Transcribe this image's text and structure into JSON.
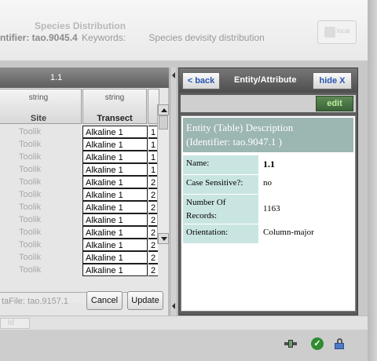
{
  "header": {
    "title": "Species Distribution",
    "id_label": "ntifier: tao.9045.4",
    "keywords_label": "Keywords:",
    "keywords_value": "Species devisity distribution",
    "badge": "local"
  },
  "table": {
    "title": "1.1",
    "columns": [
      {
        "type": "string",
        "name": "Site"
      },
      {
        "type": "string",
        "name": "Transect"
      }
    ],
    "rows": [
      {
        "site": "Toolik",
        "transect": "Alkaline 1",
        "extra": "1"
      },
      {
        "site": "Toolik",
        "transect": "Alkaline 1",
        "extra": "1"
      },
      {
        "site": "Toolik",
        "transect": "Alkaline 1",
        "extra": "1"
      },
      {
        "site": "Toolik",
        "transect": "Alkaline 1",
        "extra": "1"
      },
      {
        "site": "Toolik",
        "transect": "Alkaline 1",
        "extra": "2"
      },
      {
        "site": "Toolik",
        "transect": "Alkaline 1",
        "extra": "2"
      },
      {
        "site": "Toolik",
        "transect": "Alkaline 1",
        "extra": "2"
      },
      {
        "site": "Toolik",
        "transect": "Alkaline 1",
        "extra": "2"
      },
      {
        "site": "Toolik",
        "transect": "Alkaline 1",
        "extra": "2"
      },
      {
        "site": "Toolik",
        "transect": "Alkaline 1",
        "extra": "2"
      },
      {
        "site": "Toolik",
        "transect": "Alkaline 1",
        "extra": "2"
      },
      {
        "site": "Toolik",
        "transect": "Alkaline 1",
        "extra": "2"
      }
    ],
    "datafile": "taFile: tao.9157.1",
    "cancel_label": "Cancel",
    "update_label": "Update"
  },
  "entity_panel": {
    "back_label": "< back",
    "title": "Entity/Attribute",
    "hide_label": "hide X",
    "edit_label": "edit",
    "heading_line1": "Entity (Table) Description",
    "heading_line2": "(Identifier: tao.9047.1 )",
    "fields": [
      {
        "key": "Name:",
        "value": "1.1"
      },
      {
        "key": "Case Sensitive?:",
        "value": "no"
      },
      {
        "key_line1": "Number Of",
        "key_line2": "Records:",
        "value": "1163"
      },
      {
        "key": "Orientation:",
        "value": "Column-major"
      }
    ]
  },
  "footer": {
    "button_label": "ld"
  },
  "colors": {
    "entity_header_bg": "#9cb6b2",
    "entity_key_bg": "#c9e5e2",
    "nav_button_text": "#2a55b0",
    "edit_button_bg": "#3b6337",
    "edit_button_text": "#b7f09c"
  },
  "icons": [
    "network-icon",
    "check-icon",
    "lock-icon",
    "scroll-up-icon",
    "scroll-down-icon",
    "scroll-right-icon",
    "collapse-arrow-icon"
  ]
}
